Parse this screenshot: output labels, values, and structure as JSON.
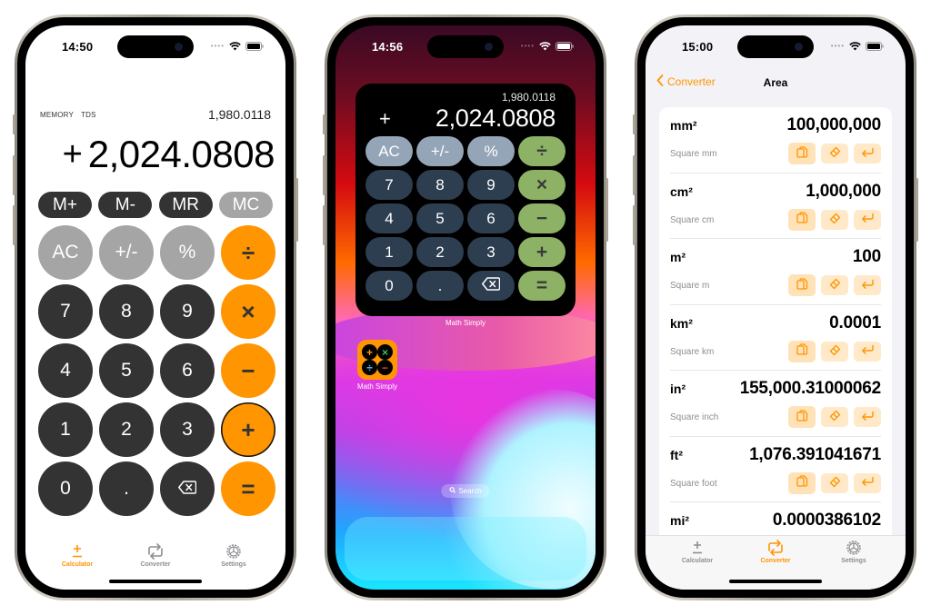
{
  "colors": {
    "accent_orange": "#ff9500",
    "key_dark": "#333333",
    "key_light_gray": "#a5a5a5",
    "widget_key_dark": "#2d3e50",
    "widget_key_fn": "#95a5b8",
    "widget_key_op": "#8db266",
    "converter_action_bg": "#ffe9c9"
  },
  "phone1": {
    "status": {
      "time": "14:50",
      "signal": "••••",
      "wifi": "wifi-icon",
      "battery": "battery-icon"
    },
    "memory": {
      "labels": [
        "MEMORY",
        "TDS"
      ],
      "value": "1,980.0118"
    },
    "display": {
      "operator": "+",
      "value": "2,024.0808"
    },
    "memory_keys": [
      {
        "label": "M+",
        "style": "dark"
      },
      {
        "label": "M-",
        "style": "dark"
      },
      {
        "label": "MR",
        "style": "dark"
      },
      {
        "label": "MC",
        "style": "light"
      }
    ],
    "keys": [
      {
        "label": "AC",
        "style": "fn"
      },
      {
        "label": "+/-",
        "style": "fn"
      },
      {
        "label": "%",
        "style": "fn"
      },
      {
        "label": "÷",
        "style": "op"
      },
      {
        "label": "7",
        "style": "num"
      },
      {
        "label": "8",
        "style": "num"
      },
      {
        "label": "9",
        "style": "num"
      },
      {
        "label": "×",
        "style": "op"
      },
      {
        "label": "4",
        "style": "num"
      },
      {
        "label": "5",
        "style": "num"
      },
      {
        "label": "6",
        "style": "num"
      },
      {
        "label": "−",
        "style": "op"
      },
      {
        "label": "1",
        "style": "num"
      },
      {
        "label": "2",
        "style": "num"
      },
      {
        "label": "3",
        "style": "num"
      },
      {
        "label": "+",
        "style": "op-active"
      },
      {
        "label": "0",
        "style": "num"
      },
      {
        "label": ".",
        "style": "num"
      },
      {
        "label": "⌫",
        "style": "num",
        "icon": "backspace-icon"
      },
      {
        "label": "=",
        "style": "op"
      }
    ],
    "tabs": [
      {
        "label": "Calculator",
        "icon": "plus-minus-icon",
        "active": true
      },
      {
        "label": "Converter",
        "icon": "convert-arrows-icon",
        "active": false
      },
      {
        "label": "Settings",
        "icon": "settings-icon",
        "active": false
      }
    ]
  },
  "phone2": {
    "status": {
      "time": "14:56",
      "signal": "••••",
      "wifi": "wifi-icon",
      "battery": "battery-icon"
    },
    "widget": {
      "memory_value": "1,980.0118",
      "operator": "+",
      "value": "2,024.0808",
      "keys": [
        {
          "label": "AC",
          "style": "fn"
        },
        {
          "label": "+/-",
          "style": "fn"
        },
        {
          "label": "%",
          "style": "fn"
        },
        {
          "label": "÷",
          "style": "op"
        },
        {
          "label": "7",
          "style": "num"
        },
        {
          "label": "8",
          "style": "num"
        },
        {
          "label": "9",
          "style": "num"
        },
        {
          "label": "×",
          "style": "op"
        },
        {
          "label": "4",
          "style": "num"
        },
        {
          "label": "5",
          "style": "num"
        },
        {
          "label": "6",
          "style": "num"
        },
        {
          "label": "−",
          "style": "op"
        },
        {
          "label": "1",
          "style": "num"
        },
        {
          "label": "2",
          "style": "num"
        },
        {
          "label": "3",
          "style": "num"
        },
        {
          "label": "+",
          "style": "op"
        },
        {
          "label": "0",
          "style": "num"
        },
        {
          "label": ".",
          "style": "num"
        },
        {
          "label": "⌫",
          "style": "num",
          "icon": "backspace-icon"
        },
        {
          "label": "=",
          "style": "op"
        }
      ],
      "label": "Math Simply"
    },
    "app_icon": {
      "label": "Math Simply",
      "symbols": [
        "+",
        "×",
        "÷",
        "−"
      ],
      "symbol_colors": [
        "#ff9500",
        "#34c759",
        "#5ac8fa",
        "#ff3b30"
      ]
    },
    "search_label": "Search"
  },
  "phone3": {
    "status": {
      "time": "15:00",
      "signal": "••••",
      "wifi": "wifi-icon",
      "battery": "battery-icon"
    },
    "nav": {
      "back_label": "Converter",
      "title": "Area"
    },
    "units": [
      {
        "symbol": "mm²",
        "name": "Square mm",
        "value": "100,000,000"
      },
      {
        "symbol": "cm²",
        "name": "Square cm",
        "value": "1,000,000"
      },
      {
        "symbol": "m²",
        "name": "Square m",
        "value": "100"
      },
      {
        "symbol": "km²",
        "name": "Square km",
        "value": "0.0001"
      },
      {
        "symbol": "in²",
        "name": "Square inch",
        "value": "155,000.31000062"
      },
      {
        "symbol": "ft²",
        "name": "Square foot",
        "value": "1,076.391041671"
      },
      {
        "symbol": "mi²",
        "name": "",
        "value": "0.0000386102"
      }
    ],
    "row_actions": [
      "copy-icon",
      "eraser-icon",
      "return-icon"
    ],
    "tabs": [
      {
        "label": "Calculator",
        "icon": "plus-minus-icon",
        "active": false
      },
      {
        "label": "Converter",
        "icon": "convert-arrows-icon",
        "active": true
      },
      {
        "label": "Settings",
        "icon": "settings-icon",
        "active": false
      }
    ]
  }
}
